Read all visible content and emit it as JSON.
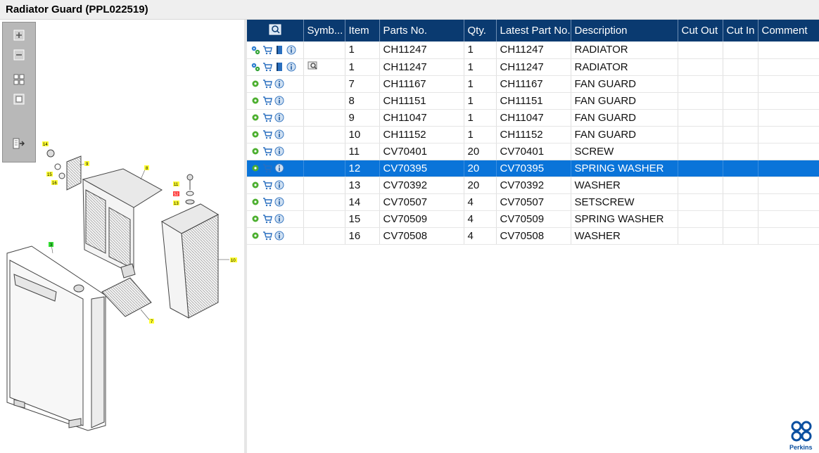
{
  "window": {
    "title": "Radiator Guard (PPL022519)"
  },
  "toolbar": {
    "buttons": [
      {
        "name": "zoom-in-button",
        "icon": "zoom-in-icon"
      },
      {
        "name": "zoom-out-button",
        "icon": "zoom-out-icon"
      },
      {
        "name": "fit-all-button",
        "icon": "fit-all-icon"
      },
      {
        "name": "fit-window-button",
        "icon": "fit-window-icon"
      },
      {
        "name": "export-button",
        "icon": "export-icon"
      }
    ]
  },
  "drawing": {
    "callouts": [
      "14",
      "15",
      "16",
      "9",
      "8",
      "11",
      "52",
      "13",
      "10",
      "3",
      "7"
    ]
  },
  "grid": {
    "headers": {
      "icon": "view-icon",
      "symb": "Symb...",
      "item": "Item",
      "parts_no": "Parts No.",
      "qty": "Qty.",
      "latest": "Latest Part No.",
      "desc": "Description",
      "cut_out": "Cut Out",
      "cut_in": "Cut In",
      "comment": "Comment"
    },
    "rows": [
      {
        "item": "1",
        "parts_no": "CH11247",
        "qty": "1",
        "latest": "CH11247",
        "desc": "RADIATOR",
        "icons": [
          "gears-icon",
          "cart-icon",
          "book-icon",
          "info-icon"
        ],
        "symb": ""
      },
      {
        "item": "1",
        "parts_no": "CH11247",
        "qty": "1",
        "latest": "CH11247",
        "desc": "RADIATOR",
        "icons": [
          "gears-icon",
          "cart-icon",
          "book-icon",
          "info-icon"
        ],
        "symb": "magnifier-image-icon"
      },
      {
        "item": "7",
        "parts_no": "CH11167",
        "qty": "1",
        "latest": "CH11167",
        "desc": "FAN GUARD",
        "icons": [
          "gear-icon",
          "cart-icon",
          "info-icon"
        ],
        "symb": ""
      },
      {
        "item": "8",
        "parts_no": "CH11151",
        "qty": "1",
        "latest": "CH11151",
        "desc": "FAN GUARD",
        "icons": [
          "gear-icon",
          "cart-icon",
          "info-icon"
        ],
        "symb": ""
      },
      {
        "item": "9",
        "parts_no": "CH11047",
        "qty": "1",
        "latest": "CH11047",
        "desc": "FAN GUARD",
        "icons": [
          "gear-icon",
          "cart-icon",
          "info-icon"
        ],
        "symb": ""
      },
      {
        "item": "10",
        "parts_no": "CH11152",
        "qty": "1",
        "latest": "CH11152",
        "desc": "FAN GUARD",
        "icons": [
          "gear-icon",
          "cart-icon",
          "info-icon"
        ],
        "symb": ""
      },
      {
        "item": "11",
        "parts_no": "CV70401",
        "qty": "20",
        "latest": "CV70401",
        "desc": "SCREW",
        "icons": [
          "gear-icon",
          "cart-icon",
          "info-icon"
        ],
        "symb": ""
      },
      {
        "item": "12",
        "parts_no": "CV70395",
        "qty": "20",
        "latest": "CV70395",
        "desc": "SPRING WASHER",
        "icons": [
          "gear-icon",
          "cart-icon",
          "info-icon"
        ],
        "symb": "",
        "selected": true
      },
      {
        "item": "13",
        "parts_no": "CV70392",
        "qty": "20",
        "latest": "CV70392",
        "desc": "WASHER",
        "icons": [
          "gear-icon",
          "cart-icon",
          "info-icon"
        ],
        "symb": ""
      },
      {
        "item": "14",
        "parts_no": "CV70507",
        "qty": "4",
        "latest": "CV70507",
        "desc": "SETSCREW",
        "icons": [
          "gear-icon",
          "cart-icon",
          "info-icon"
        ],
        "symb": ""
      },
      {
        "item": "15",
        "parts_no": "CV70509",
        "qty": "4",
        "latest": "CV70509",
        "desc": "SPRING WASHER",
        "icons": [
          "gear-icon",
          "cart-icon",
          "info-icon"
        ],
        "symb": ""
      },
      {
        "item": "16",
        "parts_no": "CV70508",
        "qty": "4",
        "latest": "CV70508",
        "desc": "WASHER",
        "icons": [
          "gear-icon",
          "cart-icon",
          "info-icon"
        ],
        "symb": ""
      }
    ]
  },
  "brand": {
    "name": "Perkins",
    "color": "#0a4fa0"
  },
  "colors": {
    "header_bg": "#0a3a70",
    "selection_bg": "#0a74d9",
    "toolbar_bg": "#b8b8b8"
  }
}
